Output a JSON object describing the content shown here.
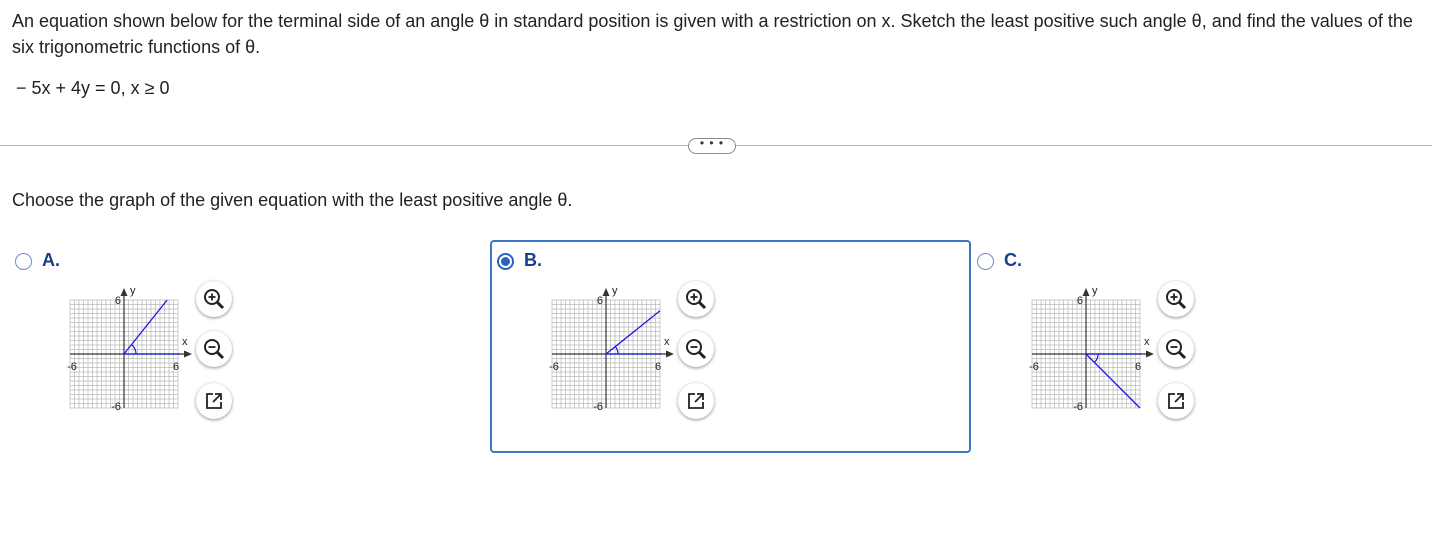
{
  "question": "An equation shown below for the terminal side of an angle θ in standard position is given with a restriction on x. Sketch the least positive such angle θ, and find the values of the six trigonometric functions of θ.",
  "equation": "− 5x + 4y = 0, x ≥ 0",
  "more_button": "• • •",
  "prompt": "Choose the graph of the given equation with the least positive angle θ.",
  "options": [
    {
      "label": "A.",
      "selected": false,
      "graph": {
        "x_label": "x",
        "y_label": "y",
        "tick_pos": "6",
        "tick_neg": "-6",
        "terminal_end": [
          4.8,
          6
        ],
        "xlim": [
          -6,
          6
        ],
        "ylim": [
          -6,
          6
        ]
      }
    },
    {
      "label": "B.",
      "selected": true,
      "graph": {
        "x_label": "x",
        "y_label": "y",
        "tick_pos": "6",
        "tick_neg": "-6",
        "terminal_end": [
          6,
          4.8
        ],
        "xlim": [
          -6,
          6
        ],
        "ylim": [
          -6,
          6
        ]
      }
    },
    {
      "label": "C.",
      "selected": false,
      "graph": {
        "x_label": "x",
        "y_label": "y",
        "tick_pos": "6",
        "tick_neg": "-6",
        "terminal_end": [
          6,
          -6
        ],
        "xlim": [
          -6,
          6
        ],
        "ylim": [
          -6,
          6
        ]
      }
    }
  ],
  "tools": [
    "zoom-in-icon",
    "zoom-out-icon",
    "open-external-icon"
  ],
  "colors": {
    "accent": "#2a62c0",
    "terminal_line": "#1a1adb",
    "selected_border": "#3a78c3"
  }
}
